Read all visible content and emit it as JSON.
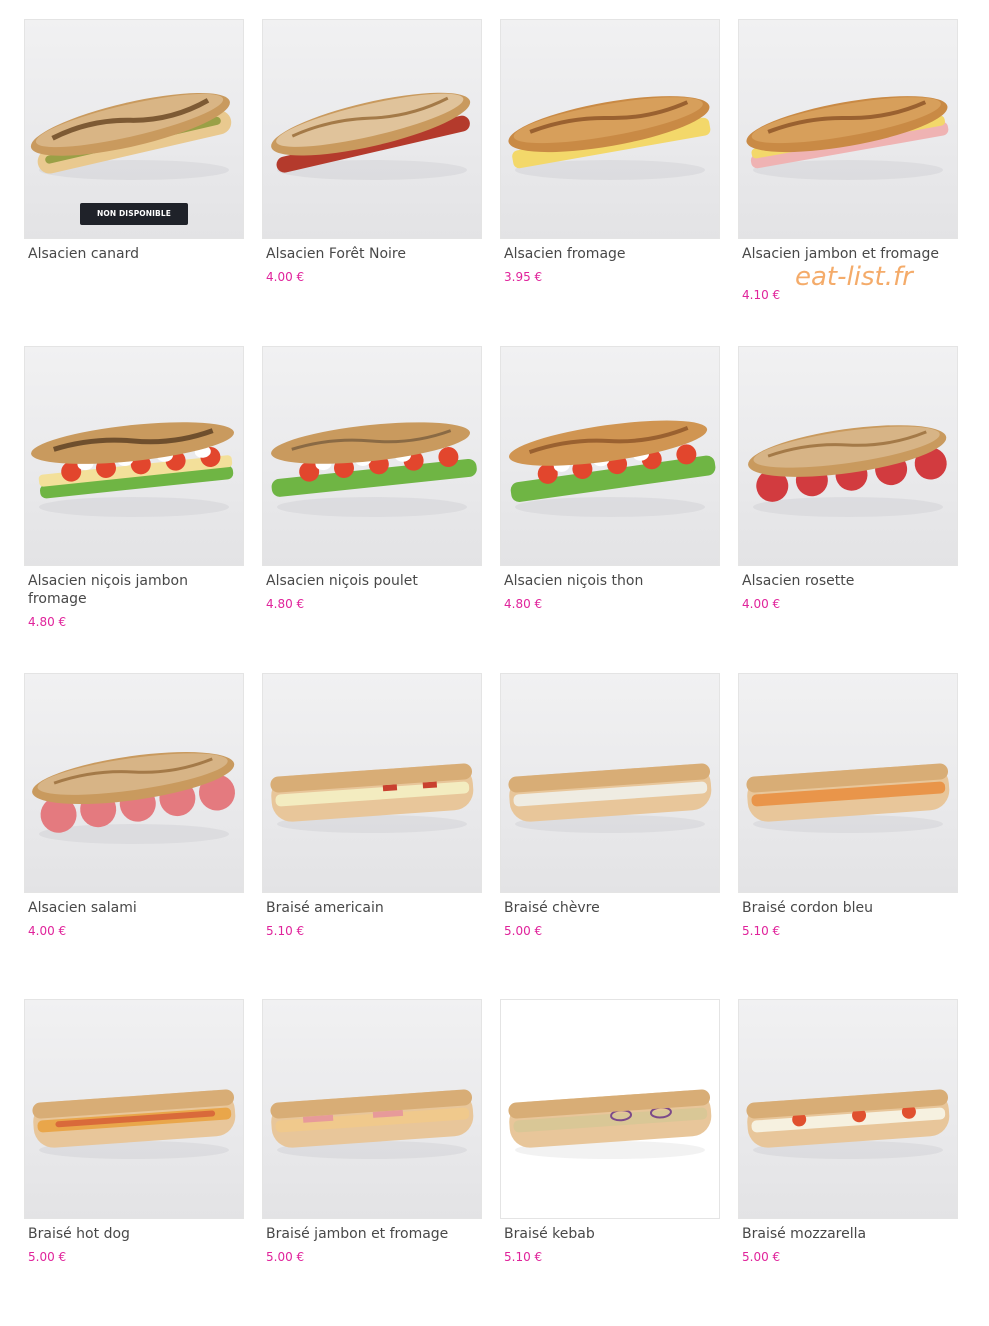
{
  "watermark": "eat-list.fr",
  "colors": {
    "price": "#e0239b",
    "name": "#484848",
    "badge_bg": "#1f2229"
  },
  "products": [
    {
      "name": "Alsacien canard",
      "price": "",
      "badge": "NON DISPONIBLE",
      "image": "rustic-baguette-pickles"
    },
    {
      "name": "Alsacien Forêt Noire",
      "price": "4.00 €",
      "badge": "",
      "image": "rustic-baguette-ham"
    },
    {
      "name": "Alsacien fromage",
      "price": "3.95 €",
      "badge": "",
      "image": "rustic-baguette-cheese"
    },
    {
      "name": "Alsacien jambon et fromage",
      "price": "4.10 €",
      "badge": "",
      "image": "rustic-baguette-ham-cheese"
    },
    {
      "name": "Alsacien niçois jambon fromage",
      "price": "4.80 €",
      "badge": "",
      "image": "rustic-baguette-nicois"
    },
    {
      "name": "Alsacien niçois poulet",
      "price": "4.80 €",
      "badge": "",
      "image": "rustic-baguette-nicois"
    },
    {
      "name": "Alsacien niçois thon",
      "price": "4.80 €",
      "badge": "",
      "image": "rustic-baguette-nicois"
    },
    {
      "name": "Alsacien rosette",
      "price": "4.00 €",
      "badge": "",
      "image": "rustic-baguette-salami"
    },
    {
      "name": "Alsacien salami",
      "price": "4.00 €",
      "badge": "",
      "image": "rustic-baguette-salami"
    },
    {
      "name": "Braisé americain",
      "price": "5.10 €",
      "badge": "",
      "image": "toasted-panini"
    },
    {
      "name": "Braisé chèvre",
      "price": "5.00 €",
      "badge": "",
      "image": "toasted-panini"
    },
    {
      "name": "Braisé cordon bleu",
      "price": "5.10 €",
      "badge": "",
      "image": "toasted-panini"
    },
    {
      "name": "Braisé hot dog",
      "price": "5.00 €",
      "badge": "",
      "image": "toasted-panini"
    },
    {
      "name": "Braisé jambon et fromage",
      "price": "5.00 €",
      "badge": "",
      "image": "toasted-panini"
    },
    {
      "name": "Braisé kebab",
      "price": "5.10 €",
      "badge": "",
      "image": "toasted-panini"
    },
    {
      "name": "Braisé mozzarella",
      "price": "5.00 €",
      "badge": "",
      "image": "toasted-panini"
    }
  ]
}
